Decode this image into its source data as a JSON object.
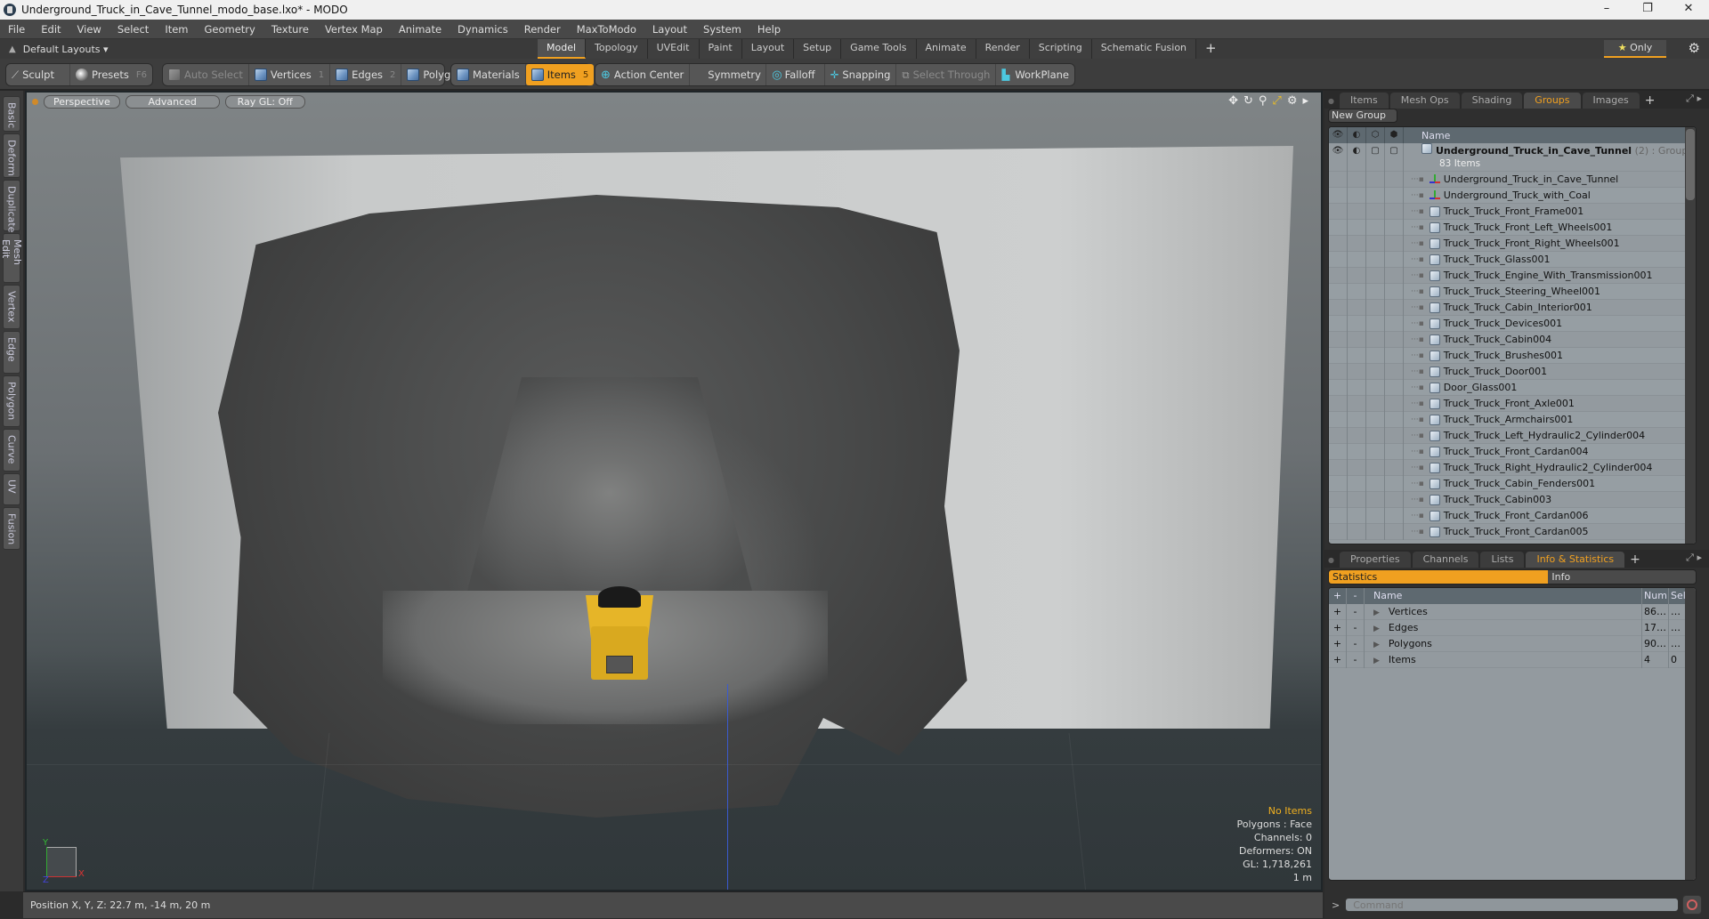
{
  "window": {
    "title": "Underground_Truck_in_Cave_Tunnel_modo_base.lxo* - MODO",
    "controls": [
      "–",
      "❐",
      "✕"
    ]
  },
  "menu": [
    "File",
    "Edit",
    "View",
    "Select",
    "Item",
    "Geometry",
    "Texture",
    "Vertex Map",
    "Animate",
    "Dynamics",
    "Render",
    "MaxToModo",
    "Layout",
    "System",
    "Help"
  ],
  "layoutbar": {
    "layouts_label": "Default Layouts ▾",
    "tabs": [
      "Model",
      "Topology",
      "UVEdit",
      "Paint",
      "Layout",
      "Setup",
      "Game Tools",
      "Animate",
      "Render",
      "Scripting",
      "Schematic Fusion"
    ],
    "active_tab": "Model",
    "plus": "+",
    "only_label": "Only",
    "star": "★",
    "gear": "⚙"
  },
  "toolbar": {
    "sculpt": "Sculpt",
    "presets": "Presets",
    "presets_key": "F6",
    "auto_select": "Auto Select",
    "vertices": "Vertices",
    "vertices_key": "1",
    "edges": "Edges",
    "edges_key": "2",
    "polygons": "Polygons",
    "materials": "Materials",
    "items": "Items",
    "items_key": "5",
    "action_center": "Action Center",
    "symmetry": "Symmetry",
    "falloff": "Falloff",
    "snapping": "Snapping",
    "select_through": "Select Through",
    "workplane": "WorkPlane"
  },
  "left_tabs": [
    "Basic",
    "Deform",
    "Duplicate",
    "Mesh Edit",
    "Vertex",
    "Edge",
    "Polygon",
    "Curve",
    "UV",
    "Fusion"
  ],
  "viewport": {
    "view_mode": "Perspective",
    "shading": "Advanced",
    "raygl": "Ray GL: Off",
    "info": {
      "selection": "No Items",
      "polygons": "Polygons : Face",
      "channels": "Channels: 0",
      "deformers": "Deformers: ON",
      "gl": "GL: 1,718,261",
      "scale": "1 m"
    },
    "axis_labels": {
      "x": "X",
      "y": "Y",
      "z": "Z"
    }
  },
  "statusbar": {
    "position": "Position X, Y, Z:   22.7 m, -14 m, 20 m"
  },
  "top_panel": {
    "tabs": [
      "Items",
      "Mesh Ops",
      "Shading",
      "Groups",
      "Images"
    ],
    "active_tab": "Groups",
    "new_group": "New Group",
    "column_name": "Name",
    "group": {
      "name": "Underground_Truck_in_Cave_Tunnel",
      "count": "(2)",
      "type": ": Group",
      "items_count": "83 Items"
    },
    "items": [
      {
        "name": "Underground_Truck_in_Cave_Tunnel",
        "icon": "locator"
      },
      {
        "name": "Underground_Truck_with_Coal",
        "icon": "locator"
      },
      {
        "name": "Truck_Truck_Front_Frame001",
        "icon": "mesh"
      },
      {
        "name": "Truck_Truck_Front_Left_Wheels001",
        "icon": "mesh"
      },
      {
        "name": "Truck_Truck_Front_Right_Wheels001",
        "icon": "mesh"
      },
      {
        "name": "Truck_Truck_Glass001",
        "icon": "mesh"
      },
      {
        "name": "Truck_Truck_Engine_With_Transmission001",
        "icon": "mesh"
      },
      {
        "name": "Truck_Truck_Steering_Wheel001",
        "icon": "mesh"
      },
      {
        "name": "Truck_Truck_Cabin_Interior001",
        "icon": "mesh"
      },
      {
        "name": "Truck_Truck_Devices001",
        "icon": "mesh"
      },
      {
        "name": "Truck_Truck_Cabin004",
        "icon": "mesh"
      },
      {
        "name": "Truck_Truck_Brushes001",
        "icon": "mesh"
      },
      {
        "name": "Truck_Truck_Door001",
        "icon": "mesh"
      },
      {
        "name": "Door_Glass001",
        "icon": "mesh"
      },
      {
        "name": "Truck_Truck_Front_Axle001",
        "icon": "mesh"
      },
      {
        "name": "Truck_Truck_Armchairs001",
        "icon": "mesh"
      },
      {
        "name": "Truck_Truck_Left_Hydraulic2_Cylinder004",
        "icon": "mesh"
      },
      {
        "name": "Truck_Truck_Front_Cardan004",
        "icon": "mesh"
      },
      {
        "name": "Truck_Truck_Right_Hydraulic2_Cylinder004",
        "icon": "mesh"
      },
      {
        "name": "Truck_Truck_Cabin_Fenders001",
        "icon": "mesh"
      },
      {
        "name": "Truck_Truck_Cabin003",
        "icon": "mesh"
      },
      {
        "name": "Truck_Truck_Front_Cardan006",
        "icon": "mesh"
      },
      {
        "name": "Truck_Truck_Front_Cardan005",
        "icon": "mesh"
      }
    ]
  },
  "bottom_panel": {
    "tabs": [
      "Properties",
      "Channels",
      "Lists",
      "Info & Statistics"
    ],
    "active_tab": "Info & Statistics",
    "toggle": [
      "Statistics",
      "Info"
    ],
    "columns": {
      "plus": "+",
      "minus": "-",
      "name": "Name",
      "num": "Num",
      "sel": "Sel"
    },
    "rows": [
      {
        "name": "Vertices",
        "num": "86…",
        "sel": "…"
      },
      {
        "name": "Edges",
        "num": "17…",
        "sel": "…"
      },
      {
        "name": "Polygons",
        "num": "90…",
        "sel": "…"
      },
      {
        "name": "Items",
        "num": "4",
        "sel": "0"
      }
    ]
  },
  "command": {
    "prompt": ">",
    "placeholder": "Command"
  }
}
